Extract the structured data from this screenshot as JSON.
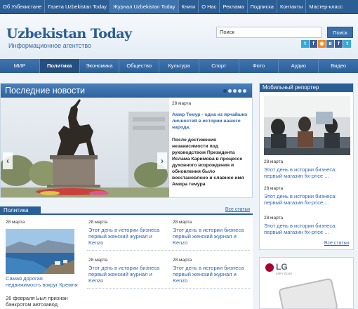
{
  "topnav": [
    "Об Узбекистане",
    "Газета Uzbekistan Today",
    "Журнал Uzbekistan Today",
    "Книги",
    "О Нас",
    "Реклама",
    "Подписка",
    "Контакты",
    "Мастер-класс"
  ],
  "header": {
    "logo": "Uzbekistan Today",
    "tagline": "Информационное агентство",
    "search": {
      "value": "Поиск",
      "button": "Поиск"
    },
    "social_icons": [
      "twitter-icon",
      "facebook-icon",
      "rss-icon",
      "vk-icon",
      "facebook-icon",
      "twitter-icon"
    ]
  },
  "mainnav": [
    "МИР",
    "Политика",
    "Экономика",
    "Общество",
    "Культура",
    "Спорт",
    "Фото",
    "Аудио",
    "Видео"
  ],
  "news": {
    "title": "Последние новости",
    "date": "28 марта",
    "lead": "Амир Темур - одна из ярчайших личностей в истории нашего народа.",
    "body": "После достижения независимости под руководством Президента Ислама Каримова в процессе духовного возрождения и обновления было восстановлено и славное имя Амира темура"
  },
  "politics": {
    "tab": "Политика",
    "all_link": "Все статьи",
    "feature": {
      "date": "28 марта",
      "title": "Самая дорогая недвижимость вокруг Кремля",
      "date2": "26 февраля Ьыл признан банкротом автозавод"
    },
    "items": [
      {
        "date": "28 марта",
        "title": "Этот день в истории бизнеса первый женский журнал и Kenzo"
      },
      {
        "date": "28 марта",
        "title": "Этот день в истории бизнеса первый женский журнал и Kenzo"
      },
      {
        "date": "28 марта",
        "title": "Этот день в истории бизнеса первый женский журнал и Kenzo"
      },
      {
        "date": "28 марта",
        "title": "Этот день в истории бизнеса первый женский журнал и Kenzo"
      }
    ]
  },
  "mobile": {
    "title": "Мобильный репортер",
    "items": [
      {
        "date": "28 марта",
        "title": "Этот день в истории бизнеса: первый магазин fix-price ..."
      },
      {
        "date": "28 марта",
        "title": "Этот день в истории бизнеса: первый магазин fix-price ..."
      },
      {
        "date": "28 марта",
        "title": "Этот день в истории бизнеса: первый магазин fix-price ..."
      }
    ],
    "all_link": "Все статьи"
  },
  "ad": {
    "brand": "LG",
    "slogan": "Life's Good"
  },
  "colors": {
    "brand_blue": "#2c5e96",
    "link_blue": "#2d66b0",
    "lg_red": "#a50034"
  }
}
